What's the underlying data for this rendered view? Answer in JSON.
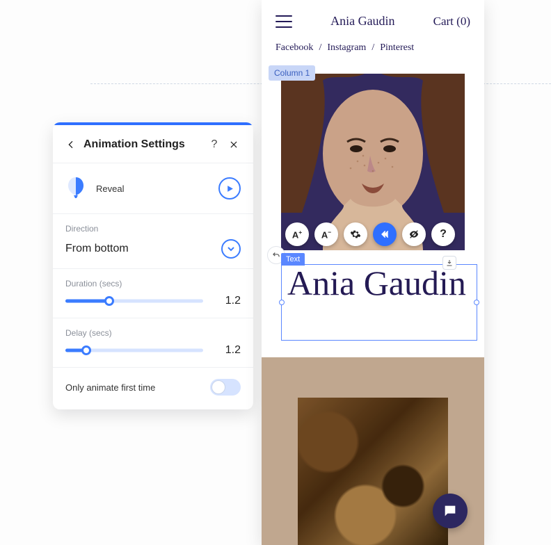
{
  "panel": {
    "title": "Animation Settings",
    "effect_name": "Reveal",
    "direction": {
      "label": "Direction",
      "value": "From bottom"
    },
    "duration": {
      "label": "Duration (secs)",
      "value": "1.2",
      "fill_pct": 32
    },
    "delay": {
      "label": "Delay (secs)",
      "value": "1.2",
      "fill_pct": 15
    },
    "only_first": {
      "label": "Only animate first time",
      "on": false
    }
  },
  "preview": {
    "brand": "Ania Gaudin",
    "cart_label": "Cart (0)",
    "social": [
      "Facebook",
      "Instagram",
      "Pinterest"
    ],
    "column_tag": "Column 1",
    "text_element_tag": "Text",
    "heading": "Ania Gaudin"
  },
  "toolbar_icons": [
    "A+",
    "A-",
    "gear",
    "animate",
    "hide",
    "help"
  ],
  "colors": {
    "accent": "#2f6fff",
    "navy": "#241a54",
    "chat": "#2c2760"
  }
}
